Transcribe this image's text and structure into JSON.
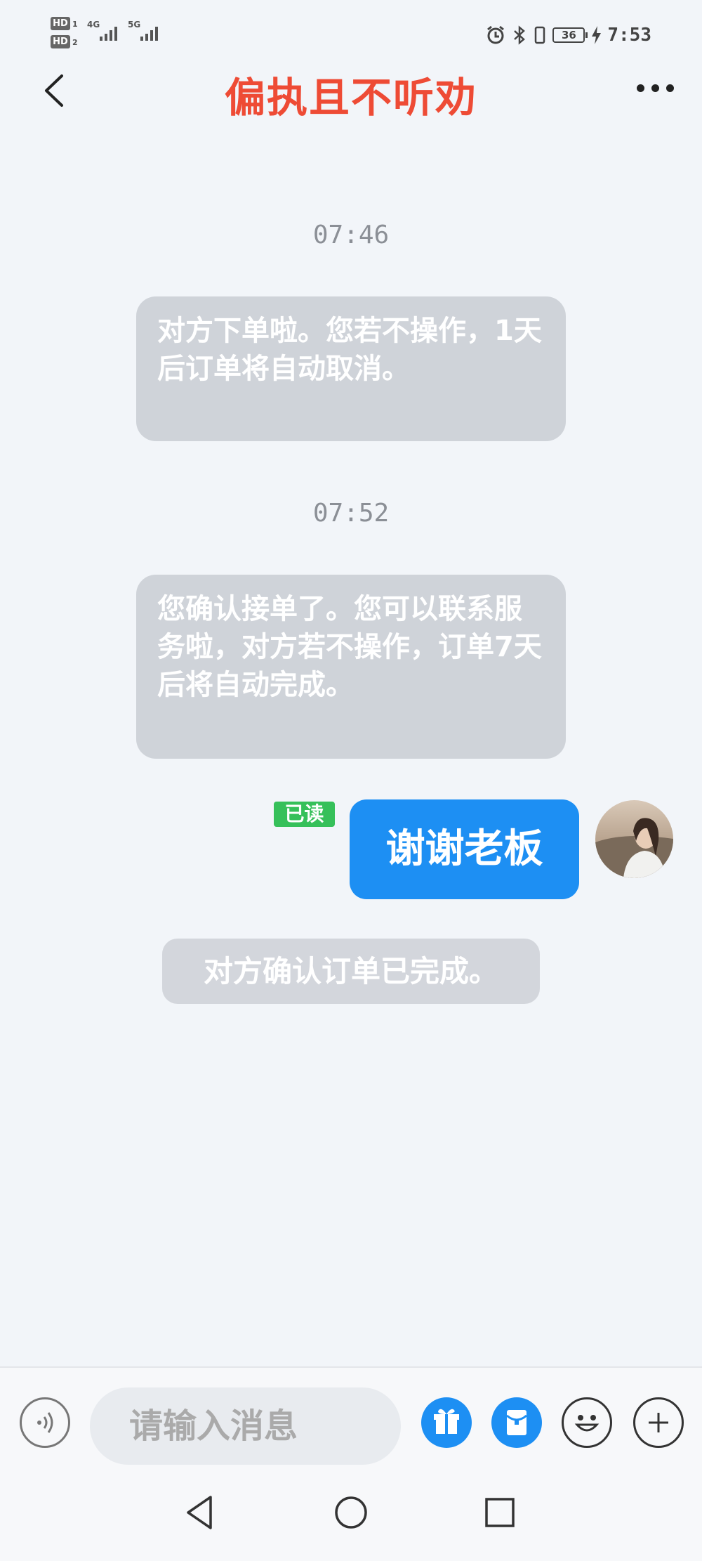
{
  "status_bar": {
    "sim1": "HD",
    "sim2": "HD",
    "sim1_num": "1",
    "sim2_num": "2",
    "net1": "4G",
    "net2": "5G",
    "battery": "36",
    "time": "7:53"
  },
  "header": {
    "title": "偏执且不听劝"
  },
  "messages": [
    {
      "time": "07:46",
      "text": "对方下单啦。您若不操作，1天后订单将自动取消。"
    },
    {
      "time": "07:52",
      "text": "您确认接单了。您可以联系服务啦，对方若不操作，订单7天后将自动完成。"
    }
  ],
  "sent": {
    "read_label": "已读",
    "text": "谢谢老板"
  },
  "system_note": "对方确认订单已完成。",
  "input": {
    "placeholder": "请输入消息"
  },
  "icons": {
    "back": "chevron-left-icon",
    "more": "more-dots-icon",
    "voice": "voice-icon",
    "gift": "gift-icon",
    "red_packet": "red-packet-icon",
    "emoji": "emoji-icon",
    "plus": "plus-icon"
  },
  "colors": {
    "title": "#ee4b35",
    "accent": "#1d8ff3",
    "read_badge": "#36c05a",
    "gray_bubble": "#cfd3d9"
  }
}
